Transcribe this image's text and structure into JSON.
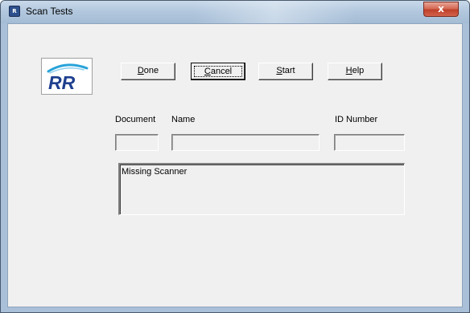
{
  "window": {
    "title": "Scan Tests",
    "close_glyph": "x"
  },
  "logo": {
    "text": "RR",
    "colors": {
      "text": "#1e3f8f",
      "swoosh": "#29a3d9"
    }
  },
  "buttons": {
    "done": {
      "mnemonic": "D",
      "rest": "one"
    },
    "cancel": {
      "mnemonic": "C",
      "rest": "ancel"
    },
    "start": {
      "mnemonic": "S",
      "rest": "tart"
    },
    "help": {
      "mnemonic": "H",
      "rest": "elp"
    }
  },
  "fields": {
    "document": {
      "label": "Document",
      "value": ""
    },
    "name": {
      "label": "Name",
      "value": ""
    },
    "id_number": {
      "label": "ID Number",
      "value": ""
    }
  },
  "status": {
    "message": "Missing Scanner"
  },
  "icons": {
    "app": "app-icon",
    "close": "close-icon"
  }
}
